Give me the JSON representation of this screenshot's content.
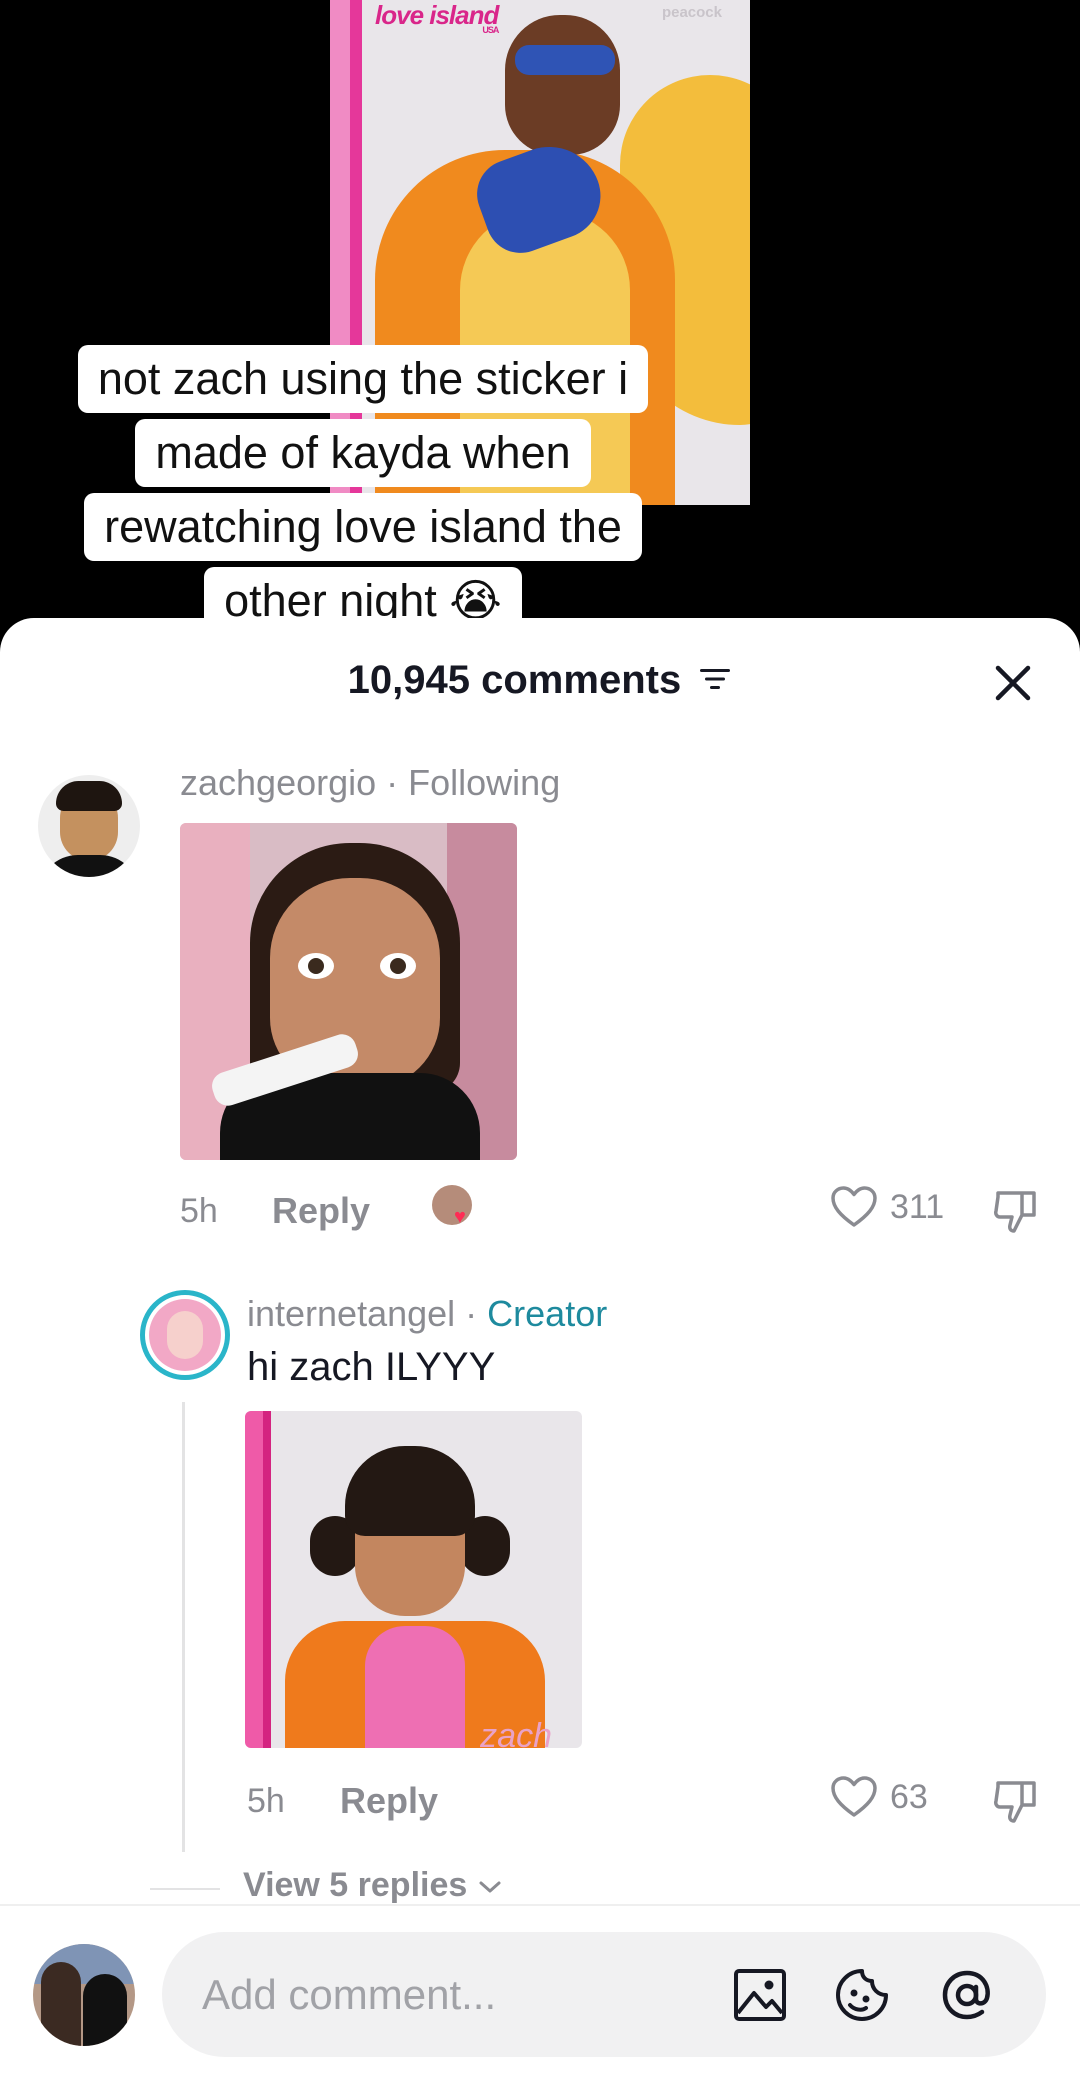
{
  "video": {
    "poster_logo": "love island",
    "poster_logo_sub": "USA",
    "poster_brand": "peacock",
    "caption_lines": [
      "not zach using the sticker i",
      "made of kayda when",
      "rewatching love island the",
      "other night 😭"
    ]
  },
  "comments_header": {
    "count_label": "10,945 comments",
    "filter_icon": "filter-icon",
    "close_icon": "close-icon"
  },
  "comments": [
    {
      "username": "zachgeorgio",
      "tag": "Following",
      "time": "5h",
      "reply_label": "Reply",
      "likes": "311"
    },
    {
      "username": "internetangel",
      "tag": "Creator",
      "text": "hi zach ILYYY",
      "sticker_watermark": "zach",
      "time": "5h",
      "reply_label": "Reply",
      "likes": "63"
    }
  ],
  "view_replies_label": "View 5 replies",
  "input": {
    "placeholder": "Add comment..."
  },
  "colors": {
    "creator_tag": "#1e8a9e",
    "muted_text": "#8a8b91",
    "input_bg": "#f1f1f2"
  }
}
